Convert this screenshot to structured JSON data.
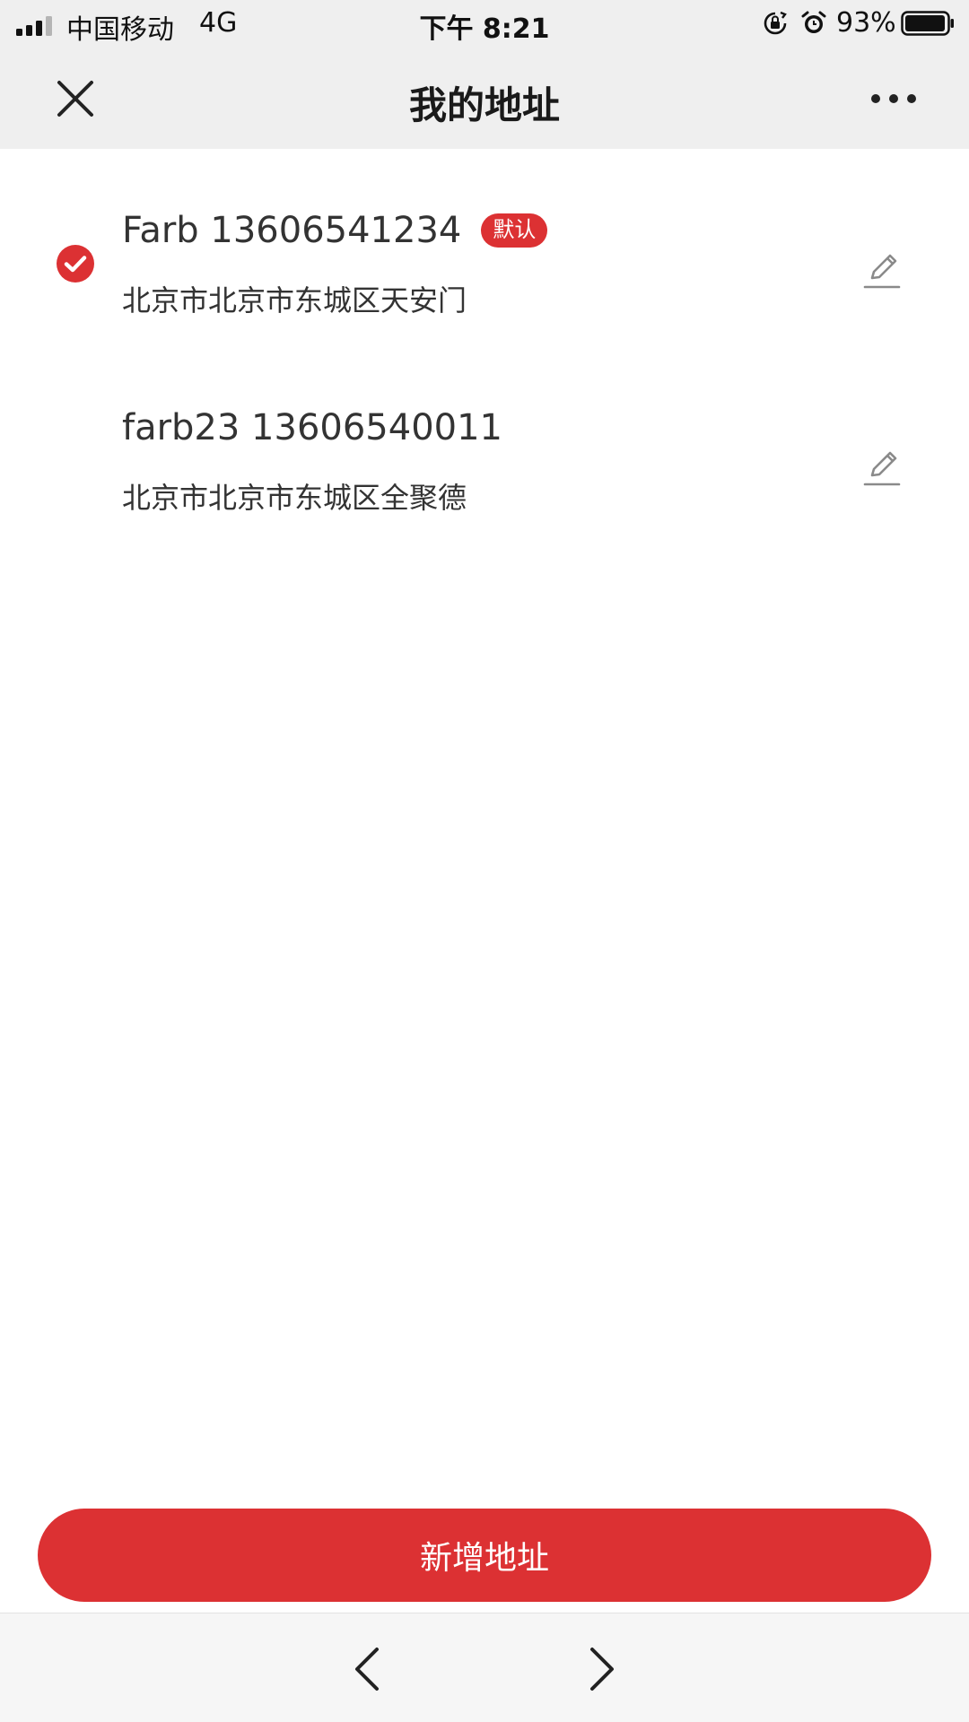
{
  "status_bar": {
    "carrier": "中国移动",
    "network": "4G",
    "time": "下午 8:21",
    "battery_percent": "93%",
    "icons": [
      "signal-icon",
      "rotation-lock-icon",
      "alarm-icon",
      "battery-icon"
    ]
  },
  "nav": {
    "title": "我的地址",
    "close_icon": "close-icon",
    "more_icon": "more-icon"
  },
  "addresses": [
    {
      "name_phone": "Farb 13606541234",
      "badge": "默认",
      "address": "北京市北京市东城区天安门",
      "selected": true
    },
    {
      "name_phone": "farb23 13606540011",
      "address": "北京市北京市东城区全聚德",
      "selected": false
    }
  ],
  "add_button": {
    "label": "新增地址"
  },
  "toolbar": {
    "back_icon": "chevron-left-icon",
    "forward_icon": "chevron-right-icon"
  },
  "colors": {
    "accent": "#dc3133",
    "nav_background": "#efefef",
    "text": "#333333"
  }
}
